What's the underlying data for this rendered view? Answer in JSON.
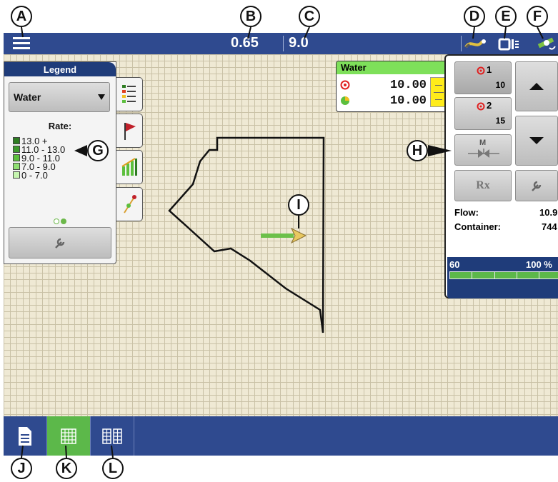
{
  "callouts": [
    "A",
    "B",
    "C",
    "D",
    "E",
    "F",
    "G",
    "H",
    "I",
    "J",
    "K",
    "L"
  ],
  "topbar": {
    "value_b": "0.65",
    "value_c": "9.0"
  },
  "legend": {
    "title": "Legend",
    "layer": "Water",
    "rate_label": "Rate:",
    "ranges": [
      {
        "label": "13.0 +",
        "color": "#2e7d22"
      },
      {
        "label": "11.0 - 13.0",
        "color": "#3d9a2c"
      },
      {
        "label": "9.0 - 11.0",
        "color": "#5cbf3d"
      },
      {
        "label": "7.0 - 9.0",
        "color": "#8fdf72"
      },
      {
        "label": "0 - 7.0",
        "color": "#c6f5b0"
      }
    ]
  },
  "water_panel": {
    "title": "Water",
    "target": "10.00",
    "actual": "10.00"
  },
  "control": {
    "preset1": {
      "label": "1",
      "value": "10"
    },
    "preset2": {
      "label": "2",
      "value": "15"
    },
    "manual_label": "M",
    "rx_label": "Rx",
    "flow_label": "Flow:",
    "flow_value": "10.9",
    "container_label": "Container:",
    "container_value": "744",
    "bar_min": "60",
    "bar_max": "100 %",
    "bar_fill": 1.0
  },
  "colors": {
    "bar_blue": "#2f4a8f",
    "map_bg": "#efe9d4",
    "green_active": "#5cb84a",
    "legend_title": "#1f3c7a"
  }
}
